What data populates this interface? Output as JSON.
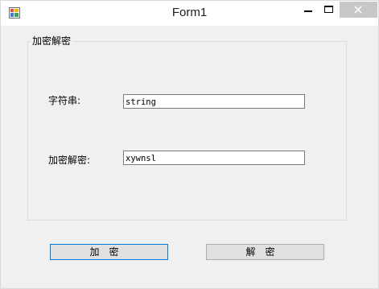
{
  "window": {
    "title": "Form1"
  },
  "group": {
    "title": "加密解密"
  },
  "fields": {
    "string_label": "字符串:",
    "string_value": "string",
    "encrypted_label": "加密解密:",
    "encrypted_value": "xywnsl"
  },
  "buttons": {
    "encrypt": "加密",
    "decrypt": "解密"
  },
  "icons": {
    "app": "app-icon",
    "minimize": "minimize-icon",
    "maximize": "maximize-icon",
    "close": "close-icon"
  },
  "colors": {
    "close_hover": "#c7c7c7",
    "focus_border": "#0078d7"
  }
}
